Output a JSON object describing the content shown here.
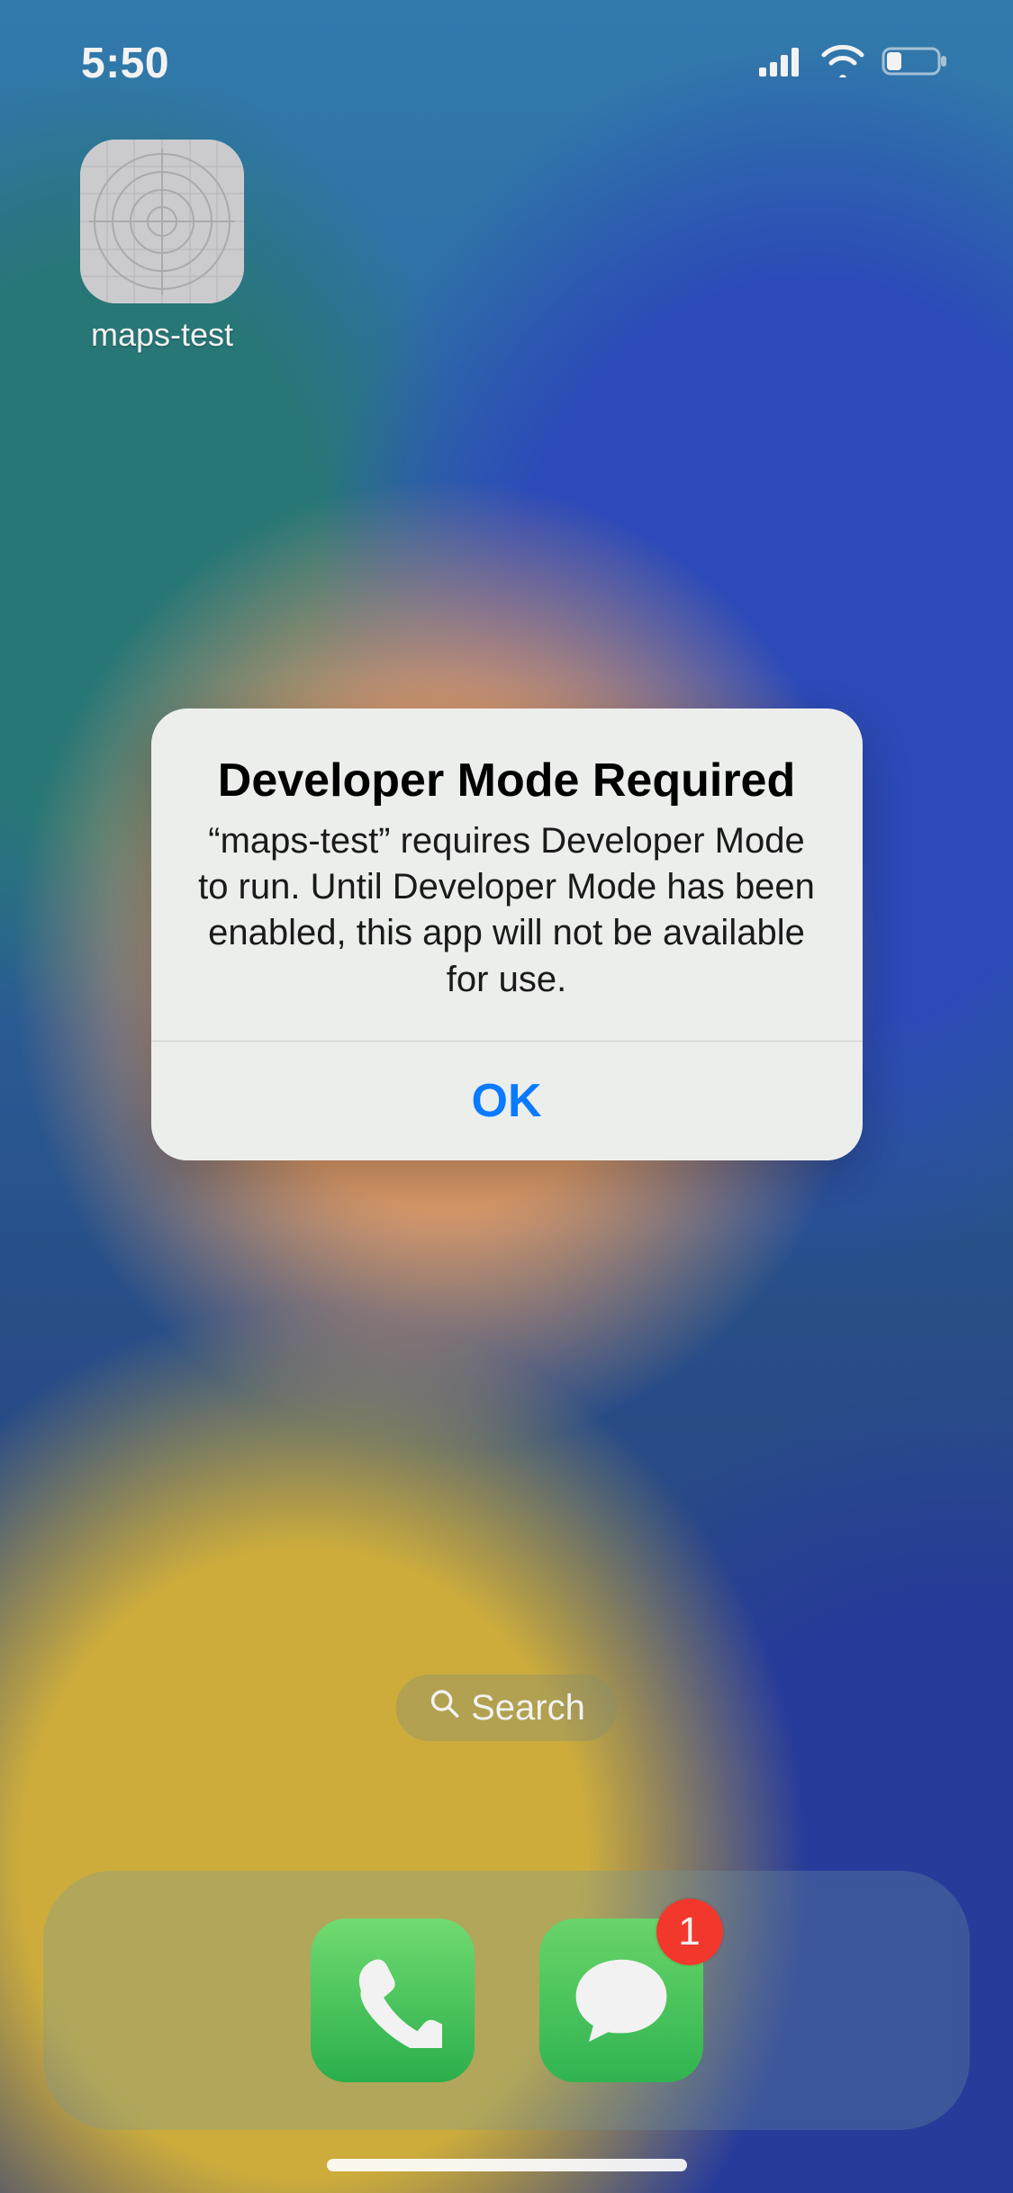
{
  "status": {
    "time": "5:50",
    "icons": {
      "cellular": "cellular-icon",
      "wifi": "wifi-icon",
      "battery": "battery-icon"
    }
  },
  "home": {
    "apps": [
      {
        "name": "maps-test",
        "icon_semantic": "placeholder-target-icon"
      }
    ]
  },
  "search": {
    "label": "Search",
    "icon_semantic": "magnifying-glass-icon"
  },
  "dock": {
    "apps": [
      {
        "name": "Phone",
        "icon_semantic": "phone-icon",
        "badge": null
      },
      {
        "name": "Messages",
        "icon_semantic": "messages-icon",
        "badge": "1"
      }
    ]
  },
  "alert": {
    "title": "Developer Mode Required",
    "message": "“maps-test” requires Developer Mode to run. Until Developer Mode has been enabled, this app will not be available for use.",
    "ok_label": "OK"
  },
  "colors": {
    "alert_action": "#0a7aff",
    "badge_red": "#ff3b30"
  }
}
